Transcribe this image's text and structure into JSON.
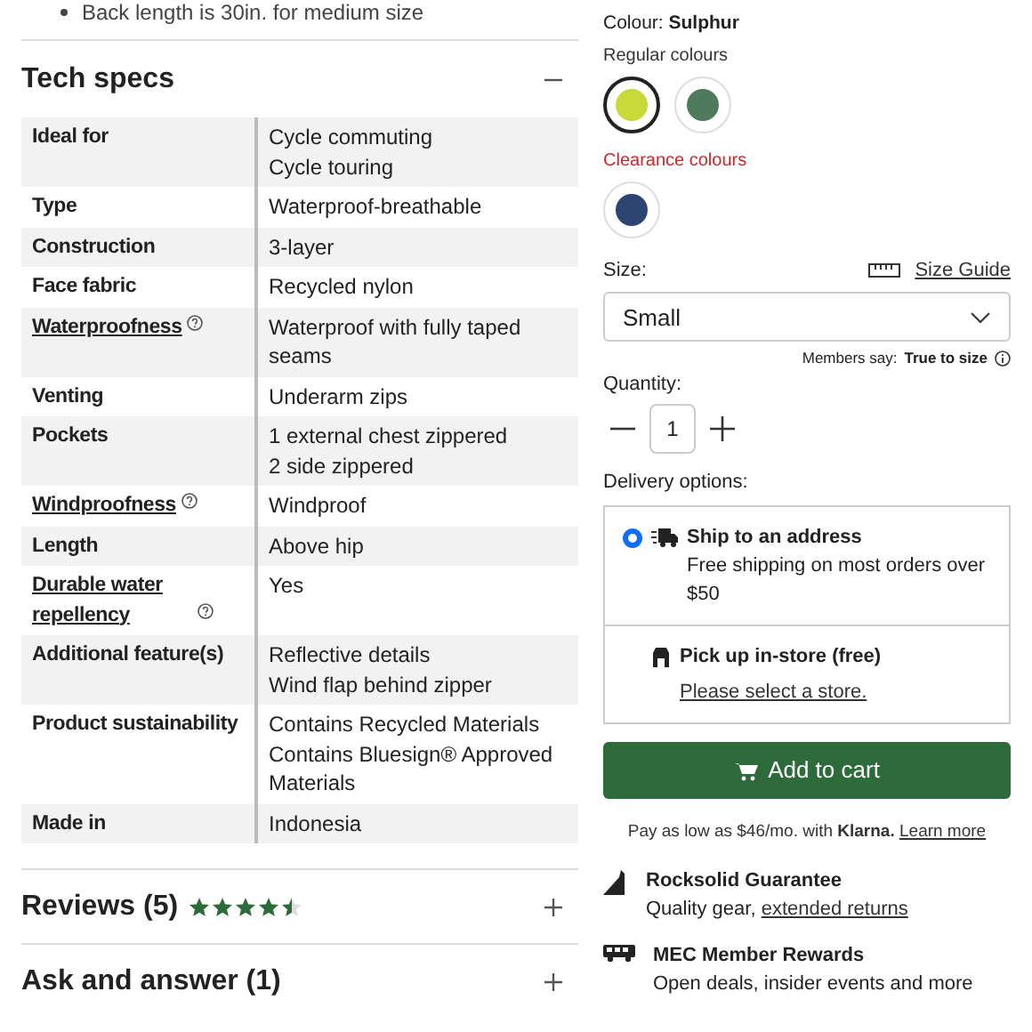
{
  "intro_bullet": "Back length is 30in. for medium size",
  "tech_specs": {
    "title": "Tech specs",
    "expanded": true,
    "rows": [
      {
        "label": "Ideal for",
        "help": false,
        "values": [
          "Cycle commuting",
          "Cycle touring"
        ]
      },
      {
        "label": "Type",
        "help": false,
        "values": [
          "Waterproof-breathable"
        ]
      },
      {
        "label": "Construction",
        "help": false,
        "values": [
          "3-layer"
        ]
      },
      {
        "label": "Face fabric",
        "help": false,
        "values": [
          "Recycled nylon"
        ]
      },
      {
        "label": "Waterproofness",
        "help": true,
        "values": [
          "Waterproof with fully taped seams"
        ]
      },
      {
        "label": "Venting",
        "help": false,
        "values": [
          "Underarm zips"
        ]
      },
      {
        "label": "Pockets",
        "help": false,
        "values": [
          "1 external chest zippered",
          "2 side zippered"
        ]
      },
      {
        "label": "Windproofness",
        "help": true,
        "values": [
          "Windproof"
        ]
      },
      {
        "label": "Length",
        "help": false,
        "values": [
          "Above hip"
        ]
      },
      {
        "label": "Durable water repellency",
        "help": true,
        "values": [
          "Yes"
        ]
      },
      {
        "label": "Additional feature(s)",
        "help": false,
        "values": [
          "Reflective details",
          "Wind flap behind zipper"
        ]
      },
      {
        "label": "Product sustainability",
        "help": false,
        "values": [
          "Contains Recycled Materials",
          "Contains Bluesign® Approved Materials"
        ]
      },
      {
        "label": "Made in",
        "help": false,
        "values": [
          "Indonesia"
        ]
      }
    ]
  },
  "sections": [
    {
      "title": "Reviews (5)",
      "stars": 4.5,
      "expanded": false
    },
    {
      "title": "Ask and answer (1)",
      "expanded": false
    }
  ],
  "colour": {
    "label": "Colour:",
    "name": "Sulphur",
    "groups": [
      {
        "kind": "regular",
        "label": "Regular colours",
        "swatches": [
          {
            "color": "#c8d93a",
            "selected": true
          },
          {
            "color": "#4f7a5c",
            "selected": false
          }
        ]
      },
      {
        "kind": "clearance",
        "label": "Clearance colours",
        "swatches": [
          {
            "color": "#2d4473",
            "selected": false
          }
        ]
      }
    ]
  },
  "size": {
    "label": "Size:",
    "guide": "Size Guide",
    "value": "Small",
    "members_say": "Members say:",
    "fit": "True to size"
  },
  "quantity": {
    "label": "Quantity:",
    "value": "1"
  },
  "delivery": {
    "label": "Delivery options:",
    "options": [
      {
        "kind": "ship",
        "selected": true,
        "title": "Ship to an address",
        "detail": "Free shipping on most orders over $50"
      },
      {
        "kind": "pickup",
        "selected": false,
        "title": "Pick up in-store (free)",
        "link": "Please select a store."
      }
    ]
  },
  "add_to_cart": "Add to cart",
  "financing": {
    "text": "Pay as low as $46/mo. with **Klarna.**",
    "link": "Learn more"
  },
  "perks": [
    {
      "kind": "guarantee",
      "title": "Rocksolid Guarantee",
      "text": "Quality gear,",
      "link": "extended returns"
    },
    {
      "kind": "rewards",
      "title": "MEC Member Rewards",
      "text": "Open deals, insider events and more"
    }
  ]
}
